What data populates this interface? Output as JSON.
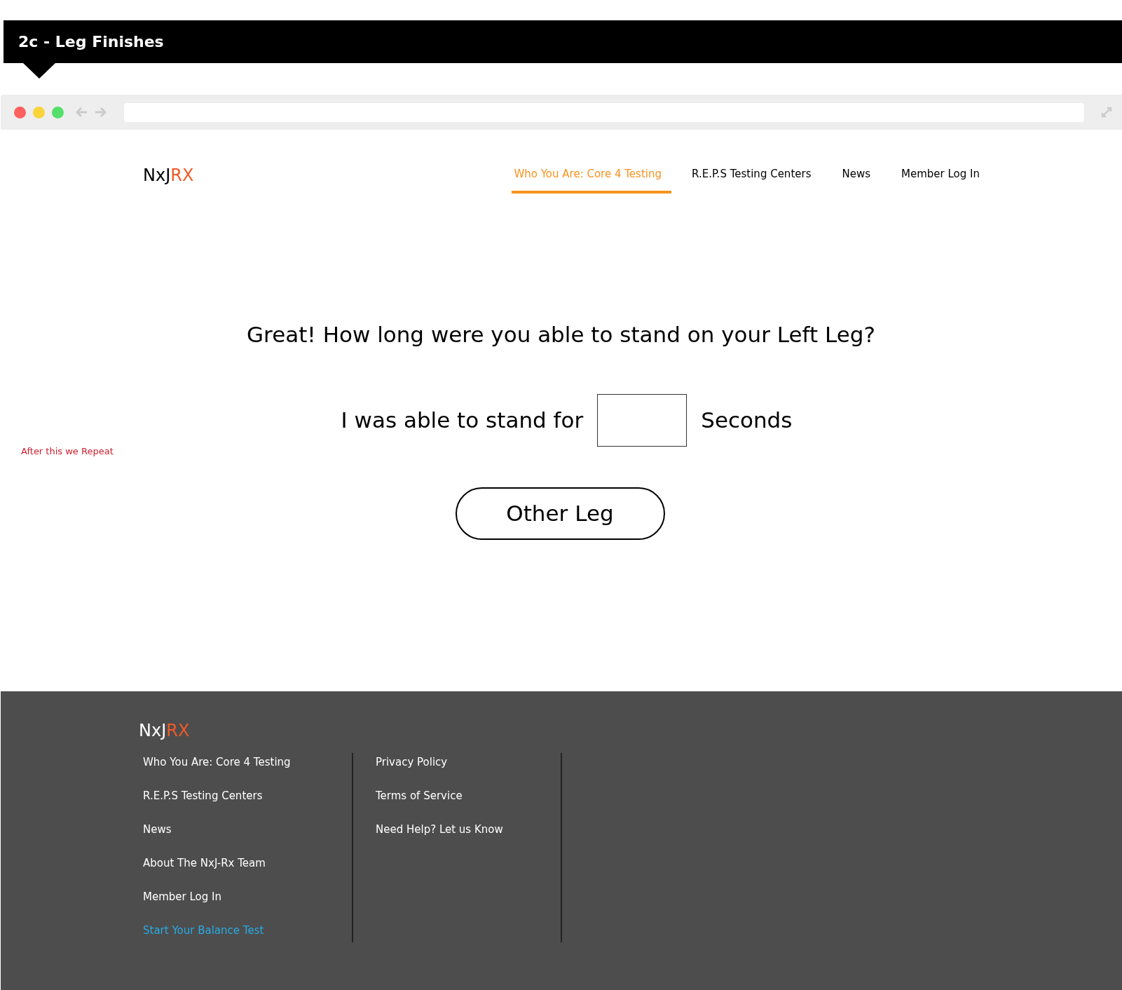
{
  "banner": {
    "title": "2c - Leg Finishes"
  },
  "header": {
    "logo": {
      "prefix": "NxJ",
      "accent": "RX"
    },
    "nav": [
      {
        "label": "Who You Are: Core 4 Testing",
        "selected": true
      },
      {
        "label": "R.E.P.S Testing Centers",
        "selected": false
      },
      {
        "label": "News",
        "selected": false
      },
      {
        "label": "Member Log In",
        "selected": false
      }
    ]
  },
  "annotation": "After this we Repeat",
  "question": "Great! How long were you able to stand on your Left Leg?",
  "answer": {
    "before": "I was able to stand for",
    "after": "Seconds"
  },
  "button": "Other Leg",
  "footer": {
    "logo": {
      "prefix": "NxJ",
      "accent": "RX"
    },
    "columns": [
      [
        {
          "label": "Who You Are: Core 4 Testing",
          "kind": "link"
        },
        {
          "label": "R.E.P.S Testing Centers",
          "kind": "link"
        },
        {
          "label": "News",
          "kind": "link"
        },
        {
          "label": "About The NxJ-Rx Team",
          "kind": "link"
        },
        {
          "label": "Member Log In",
          "kind": "link"
        },
        {
          "label": "Start Your Balance Test",
          "kind": "cta"
        }
      ],
      [
        {
          "label": "Privacy Policy",
          "kind": "link"
        },
        {
          "label": "Terms of Service",
          "kind": "link"
        },
        {
          "label": "Need Help? Let us Know",
          "kind": "link"
        }
      ]
    ]
  }
}
